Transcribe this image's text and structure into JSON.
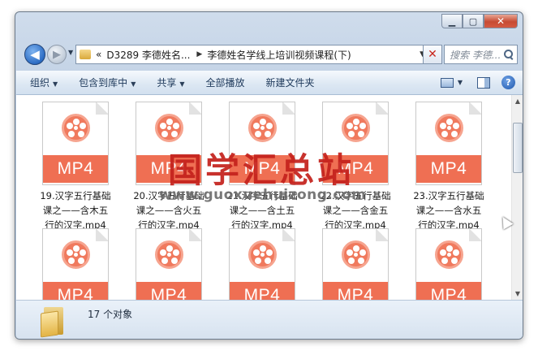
{
  "window": {
    "caption": {
      "minimize": "▁",
      "maximize": "▢",
      "close": "✕"
    }
  },
  "nav": {
    "back_glyph": "◀",
    "forward_glyph": "▶",
    "recent_glyph": "▼",
    "address": {
      "prefix": "«",
      "segment1": "D3289 李德姓名...",
      "chevron": "▶",
      "segment2": "李德姓名学线上培训视频课程(下)",
      "dropdown": "▼"
    },
    "refresh_glyph": "✕",
    "search_placeholder": "搜索 李德..."
  },
  "toolbar": {
    "organize": "组织",
    "include_in_library": "包含到库中",
    "share": "共享",
    "play_all": "全部播放",
    "new_folder": "新建文件夹",
    "caret": "▼",
    "help": "?"
  },
  "files": [
    {
      "badge": "MP4",
      "line1": "19.汉字五行基础",
      "line2": "课之——含木五",
      "line3": "行的汉字.mp4"
    },
    {
      "badge": "MP4",
      "line1": "20.汉字五行基础",
      "line2": "课之——含火五",
      "line3": "行的汉字.mp4"
    },
    {
      "badge": "MP4",
      "line1": "21.汉字五行基础",
      "line2": "课之——含土五",
      "line3": "行的汉字.mp4"
    },
    {
      "badge": "MP4",
      "line1": "22.汉字五行基础",
      "line2": "课之——含金五",
      "line3": "行的汉字.mp4"
    },
    {
      "badge": "MP4",
      "line1": "23.汉字五行基础",
      "line2": "课之——含水五",
      "line3": "行的汉字.mp4"
    },
    {
      "badge": "MP4"
    },
    {
      "badge": "MP4"
    },
    {
      "badge": "MP4"
    },
    {
      "badge": "MP4"
    },
    {
      "badge": "MP4"
    }
  ],
  "scrollbar": {
    "up": "▲",
    "down": "▼"
  },
  "status": {
    "item_count": "17 个对象"
  },
  "watermark": {
    "title": "国学汇总站",
    "url": "www.guoxuehuizong.com"
  },
  "colors": {
    "mp4_badge": "#ef6f53",
    "reel": "#f07a5e",
    "watermark_red": "#c4211c"
  }
}
